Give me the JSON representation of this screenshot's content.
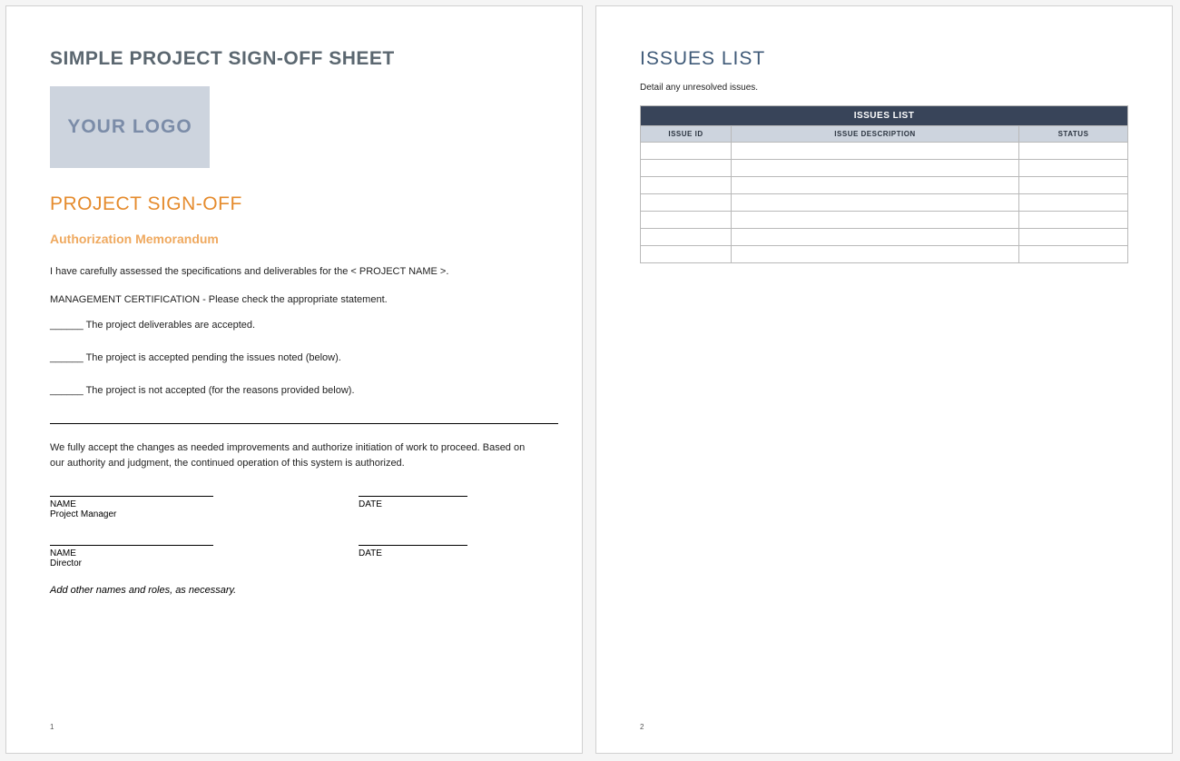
{
  "page1": {
    "docTitle": "SIMPLE PROJECT SIGN-OFF SHEET",
    "logoText": "YOUR LOGO",
    "sectionHeading": "PROJECT SIGN-OFF",
    "subHeading": "Authorization Memorandum",
    "intro": "I have carefully assessed the specifications and deliverables for the < PROJECT NAME >.",
    "mgmtCert": "MANAGEMENT CERTIFICATION - Please check the appropriate statement.",
    "opt1": "______ The project deliverables are accepted.",
    "opt2": "______ The project is accepted pending the issues noted (below).",
    "opt3": "______ The project  is not accepted (for the reasons provided below).",
    "acceptText": "We fully accept the changes as needed improvements and authorize initiation of work to proceed. Based on our authority and judgment, the continued operation of this system is authorized.",
    "sig": {
      "nameLbl": "NAME",
      "dateLbl": "DATE",
      "role1": "Project Manager",
      "role2": "Director"
    },
    "addNote": "Add other names and roles, as necessary.",
    "pageNum": "1"
  },
  "page2": {
    "title": "ISSUES LIST",
    "sub": "Detail any unresolved issues.",
    "tableTitle": "ISSUES LIST",
    "cols": {
      "id": "ISSUE ID",
      "desc": "ISSUE DESCRIPTION",
      "status": "STATUS"
    },
    "rows": [
      {
        "id": "",
        "desc": "",
        "status": ""
      },
      {
        "id": "",
        "desc": "",
        "status": ""
      },
      {
        "id": "",
        "desc": "",
        "status": ""
      },
      {
        "id": "",
        "desc": "",
        "status": ""
      },
      {
        "id": "",
        "desc": "",
        "status": ""
      },
      {
        "id": "",
        "desc": "",
        "status": ""
      },
      {
        "id": "",
        "desc": "",
        "status": ""
      }
    ],
    "pageNum": "2"
  }
}
